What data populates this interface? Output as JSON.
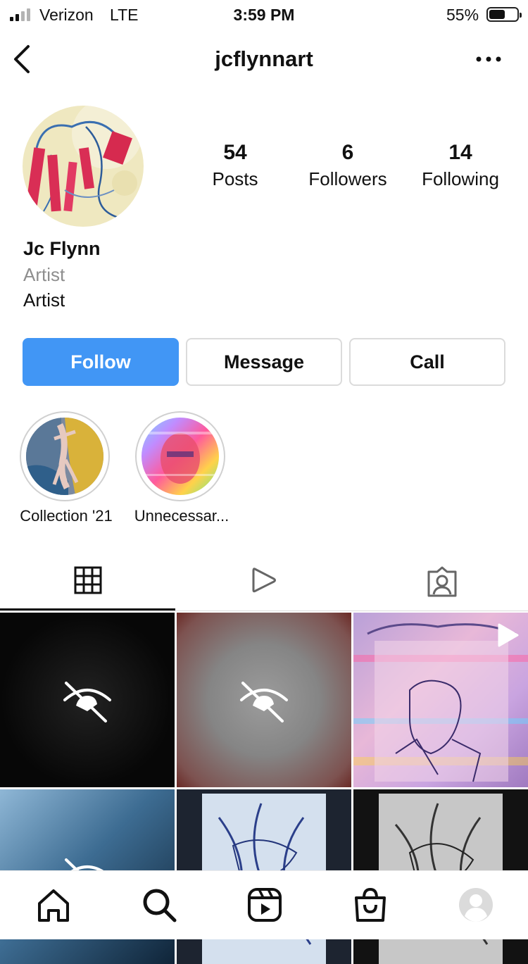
{
  "status_bar": {
    "carrier": "Verizon",
    "network": "LTE",
    "time": "3:59 PM",
    "battery_percent": "55%"
  },
  "header": {
    "username": "jcflynnart",
    "back_icon": "chevron-left-icon",
    "more_icon": "ellipsis-icon"
  },
  "profile": {
    "stats": [
      {
        "value": "54",
        "label": "Posts"
      },
      {
        "value": "6",
        "label": "Followers"
      },
      {
        "value": "14",
        "label": "Following"
      }
    ],
    "name": "Jc Flynn",
    "category": "Artist",
    "bio": "Artist"
  },
  "actions": {
    "follow": "Follow",
    "message": "Message",
    "call": "Call",
    "follow_color": "#4196f5"
  },
  "highlights": [
    {
      "label": "Collection '21"
    },
    {
      "label": "Unnecessar..."
    }
  ],
  "tabs": [
    {
      "icon": "grid-icon",
      "selected": true
    },
    {
      "icon": "reels-play-icon",
      "selected": false
    },
    {
      "icon": "tagged-person-icon",
      "selected": false
    }
  ],
  "posts": [
    {
      "kind": "hidden",
      "icon": "eye-slash-icon"
    },
    {
      "kind": "hidden",
      "icon": "eye-slash-icon"
    },
    {
      "kind": "reel",
      "icon": "play-icon"
    },
    {
      "kind": "hidden",
      "icon": "eye-slash-icon"
    },
    {
      "kind": "image"
    },
    {
      "kind": "image"
    }
  ],
  "bottom_nav": [
    {
      "icon": "home-icon"
    },
    {
      "icon": "search-icon"
    },
    {
      "icon": "reels-icon"
    },
    {
      "icon": "shop-icon"
    },
    {
      "icon": "profile-icon"
    }
  ]
}
